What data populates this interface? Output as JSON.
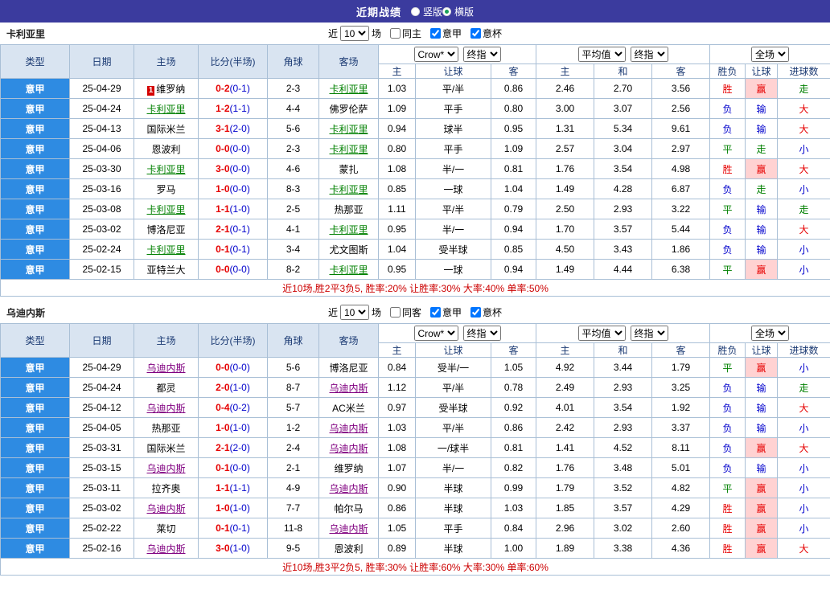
{
  "topbar": {
    "title": "近期战绩",
    "layout_options": [
      {
        "label": "竖版",
        "selected": false
      },
      {
        "label": "横版",
        "selected": true
      }
    ]
  },
  "colors": {
    "topbar_bg": "#3b3b9e",
    "league_blue": "#2e8be2",
    "header_bg": "#d9e4f1",
    "border": "#a9bfd6",
    "win_red": "#e60000",
    "lose_blue": "#0000cc",
    "draw_green": "#008000",
    "focus_green": "#008000",
    "focus_purple": "#800080",
    "summary_red": "#cc0000",
    "win_highlight_bg": "#ffd2d2"
  },
  "result_color_map": {
    "胜": "red",
    "赢": "red",
    "大": "red",
    "负": "blue",
    "输": "blue",
    "小": "blue",
    "平": "green",
    "走": "green"
  },
  "columns": {
    "static": [
      "类型",
      "日期",
      "主场",
      "比分(半场)",
      "角球",
      "客场"
    ],
    "asian_sub": [
      "主",
      "让球",
      "客"
    ],
    "euro_sub": [
      "主",
      "和",
      "客"
    ],
    "result_sub": [
      "胜负",
      "让球",
      "进球数"
    ]
  },
  "sections": [
    {
      "team": "卡利亚里",
      "focus_class": "green",
      "filter": {
        "prefix": "近",
        "count": "10",
        "suffix": "场",
        "checkboxes": [
          {
            "label": "同主",
            "checked": false
          },
          {
            "label": "意甲",
            "checked": true
          },
          {
            "label": "意杯",
            "checked": true
          }
        ]
      },
      "dropdowns": {
        "asian": [
          "Crow*",
          "终指"
        ],
        "euro": [
          "平均值",
          "终指"
        ],
        "result": [
          "全场"
        ]
      },
      "rows": [
        {
          "league": "意甲",
          "date": "25-04-29",
          "home": "维罗纳",
          "home_badge": "1",
          "home_focus": false,
          "score": "0-2",
          "half": "(0-1)",
          "corners": "2-3",
          "away": "卡利亚里",
          "away_focus": true,
          "asian": [
            "1.03",
            "平/半",
            "0.86"
          ],
          "euro": [
            "2.46",
            "2.70",
            "3.56"
          ],
          "results": [
            "胜",
            "赢",
            "走"
          ]
        },
        {
          "league": "意甲",
          "date": "25-04-24",
          "home": "卡利亚里",
          "home_focus": true,
          "score": "1-2",
          "half": "(1-1)",
          "corners": "4-4",
          "away": "佛罗伦萨",
          "away_focus": false,
          "asian": [
            "1.09",
            "平手",
            "0.80"
          ],
          "euro": [
            "3.00",
            "3.07",
            "2.56"
          ],
          "results": [
            "负",
            "输",
            "大"
          ]
        },
        {
          "league": "意甲",
          "date": "25-04-13",
          "home": "国际米兰",
          "home_focus": false,
          "score": "3-1",
          "half": "(2-0)",
          "corners": "5-6",
          "away": "卡利亚里",
          "away_focus": true,
          "asian": [
            "0.94",
            "球半",
            "0.95"
          ],
          "euro": [
            "1.31",
            "5.34",
            "9.61"
          ],
          "results": [
            "负",
            "输",
            "大"
          ]
        },
        {
          "league": "意甲",
          "date": "25-04-06",
          "home": "恩波利",
          "home_focus": false,
          "score": "0-0",
          "half": "(0-0)",
          "corners": "2-3",
          "away": "卡利亚里",
          "away_focus": true,
          "asian": [
            "0.80",
            "平手",
            "1.09"
          ],
          "euro": [
            "2.57",
            "3.04",
            "2.97"
          ],
          "results": [
            "平",
            "走",
            "小"
          ]
        },
        {
          "league": "意甲",
          "date": "25-03-30",
          "home": "卡利亚里",
          "home_focus": true,
          "score": "3-0",
          "half": "(0-0)",
          "corners": "4-6",
          "away": "蒙扎",
          "away_focus": false,
          "asian": [
            "1.08",
            "半/一",
            "0.81"
          ],
          "euro": [
            "1.76",
            "3.54",
            "4.98"
          ],
          "results": [
            "胜",
            "赢",
            "大"
          ]
        },
        {
          "league": "意甲",
          "date": "25-03-16",
          "home": "罗马",
          "home_focus": false,
          "score": "1-0",
          "half": "(0-0)",
          "corners": "8-3",
          "away": "卡利亚里",
          "away_focus": true,
          "asian": [
            "0.85",
            "一球",
            "1.04"
          ],
          "euro": [
            "1.49",
            "4.28",
            "6.87"
          ],
          "results": [
            "负",
            "走",
            "小"
          ]
        },
        {
          "league": "意甲",
          "date": "25-03-08",
          "home": "卡利亚里",
          "home_focus": true,
          "score": "1-1",
          "half": "(1-0)",
          "corners": "2-5",
          "away": "热那亚",
          "away_focus": false,
          "asian": [
            "1.11",
            "平/半",
            "0.79"
          ],
          "euro": [
            "2.50",
            "2.93",
            "3.22"
          ],
          "results": [
            "平",
            "输",
            "走"
          ]
        },
        {
          "league": "意甲",
          "date": "25-03-02",
          "home": "博洛尼亚",
          "home_focus": false,
          "score": "2-1",
          "half": "(0-1)",
          "corners": "4-1",
          "away": "卡利亚里",
          "away_focus": true,
          "asian": [
            "0.95",
            "半/一",
            "0.94"
          ],
          "euro": [
            "1.70",
            "3.57",
            "5.44"
          ],
          "results": [
            "负",
            "输",
            "大"
          ]
        },
        {
          "league": "意甲",
          "date": "25-02-24",
          "home": "卡利亚里",
          "home_focus": true,
          "score": "0-1",
          "half": "(0-1)",
          "corners": "3-4",
          "away": "尤文图斯",
          "away_focus": false,
          "asian": [
            "1.04",
            "受半球",
            "0.85"
          ],
          "euro": [
            "4.50",
            "3.43",
            "1.86"
          ],
          "results": [
            "负",
            "输",
            "小"
          ]
        },
        {
          "league": "意甲",
          "date": "25-02-15",
          "home": "亚特兰大",
          "home_focus": false,
          "score": "0-0",
          "half": "(0-0)",
          "corners": "8-2",
          "away": "卡利亚里",
          "away_focus": true,
          "asian": [
            "0.95",
            "一球",
            "0.94"
          ],
          "euro": [
            "1.49",
            "4.44",
            "6.38"
          ],
          "results": [
            "平",
            "赢",
            "小"
          ]
        }
      ],
      "summary": "近10场,胜2平3负5, 胜率:20% 让胜率:30% 大率:40% 单率:50%"
    },
    {
      "team": "乌迪内斯",
      "focus_class": "purple",
      "filter": {
        "prefix": "近",
        "count": "10",
        "suffix": "场",
        "checkboxes": [
          {
            "label": "同客",
            "checked": false
          },
          {
            "label": "意甲",
            "checked": true
          },
          {
            "label": "意杯",
            "checked": true
          }
        ]
      },
      "dropdowns": {
        "asian": [
          "Crow*",
          "终指"
        ],
        "euro": [
          "平均值",
          "终指"
        ],
        "result": [
          "全场"
        ]
      },
      "rows": [
        {
          "league": "意甲",
          "date": "25-04-29",
          "home": "乌迪内斯",
          "home_focus": true,
          "score": "0-0",
          "half": "(0-0)",
          "corners": "5-6",
          "away": "博洛尼亚",
          "away_focus": false,
          "asian": [
            "0.84",
            "受半/一",
            "1.05"
          ],
          "euro": [
            "4.92",
            "3.44",
            "1.79"
          ],
          "results": [
            "平",
            "赢",
            "小"
          ]
        },
        {
          "league": "意甲",
          "date": "25-04-24",
          "home": "都灵",
          "home_focus": false,
          "score": "2-0",
          "half": "(1-0)",
          "corners": "8-7",
          "away": "乌迪内斯",
          "away_focus": true,
          "asian": [
            "1.12",
            "平/半",
            "0.78"
          ],
          "euro": [
            "2.49",
            "2.93",
            "3.25"
          ],
          "results": [
            "负",
            "输",
            "走"
          ]
        },
        {
          "league": "意甲",
          "date": "25-04-12",
          "home": "乌迪内斯",
          "home_focus": true,
          "score": "0-4",
          "half": "(0-2)",
          "corners": "5-7",
          "away": "AC米兰",
          "away_focus": false,
          "asian": [
            "0.97",
            "受半球",
            "0.92"
          ],
          "euro": [
            "4.01",
            "3.54",
            "1.92"
          ],
          "results": [
            "负",
            "输",
            "大"
          ]
        },
        {
          "league": "意甲",
          "date": "25-04-05",
          "home": "热那亚",
          "home_focus": false,
          "score": "1-0",
          "half": "(1-0)",
          "corners": "1-2",
          "away": "乌迪内斯",
          "away_focus": true,
          "asian": [
            "1.03",
            "平/半",
            "0.86"
          ],
          "euro": [
            "2.42",
            "2.93",
            "3.37"
          ],
          "results": [
            "负",
            "输",
            "小"
          ]
        },
        {
          "league": "意甲",
          "date": "25-03-31",
          "home": "国际米兰",
          "home_focus": false,
          "score": "2-1",
          "half": "(2-0)",
          "corners": "2-4",
          "away": "乌迪内斯",
          "away_focus": true,
          "asian": [
            "1.08",
            "一/球半",
            "0.81"
          ],
          "euro": [
            "1.41",
            "4.52",
            "8.11"
          ],
          "results": [
            "负",
            "赢",
            "大"
          ]
        },
        {
          "league": "意甲",
          "date": "25-03-15",
          "home": "乌迪内斯",
          "home_focus": true,
          "score": "0-1",
          "half": "(0-0)",
          "corners": "2-1",
          "away": "维罗纳",
          "away_focus": false,
          "asian": [
            "1.07",
            "半/一",
            "0.82"
          ],
          "euro": [
            "1.76",
            "3.48",
            "5.01"
          ],
          "results": [
            "负",
            "输",
            "小"
          ]
        },
        {
          "league": "意甲",
          "date": "25-03-11",
          "home": "拉齐奥",
          "home_focus": false,
          "score": "1-1",
          "half": "(1-1)",
          "corners": "4-9",
          "away": "乌迪内斯",
          "away_focus": true,
          "asian": [
            "0.90",
            "半球",
            "0.99"
          ],
          "euro": [
            "1.79",
            "3.52",
            "4.82"
          ],
          "results": [
            "平",
            "赢",
            "小"
          ]
        },
        {
          "league": "意甲",
          "date": "25-03-02",
          "home": "乌迪内斯",
          "home_focus": true,
          "score": "1-0",
          "half": "(1-0)",
          "corners": "7-7",
          "away": "帕尔马",
          "away_focus": false,
          "asian": [
            "0.86",
            "半球",
            "1.03"
          ],
          "euro": [
            "1.85",
            "3.57",
            "4.29"
          ],
          "results": [
            "胜",
            "赢",
            "小"
          ]
        },
        {
          "league": "意甲",
          "date": "25-02-22",
          "home": "莱切",
          "home_focus": false,
          "score": "0-1",
          "half": "(0-1)",
          "corners": "11-8",
          "away": "乌迪内斯",
          "away_focus": true,
          "asian": [
            "1.05",
            "平手",
            "0.84"
          ],
          "euro": [
            "2.96",
            "3.02",
            "2.60"
          ],
          "results": [
            "胜",
            "赢",
            "小"
          ]
        },
        {
          "league": "意甲",
          "date": "25-02-16",
          "home": "乌迪内斯",
          "home_focus": true,
          "score": "3-0",
          "half": "(1-0)",
          "corners": "9-5",
          "away": "恩波利",
          "away_focus": false,
          "asian": [
            "0.89",
            "半球",
            "1.00"
          ],
          "euro": [
            "1.89",
            "3.38",
            "4.36"
          ],
          "results": [
            "胜",
            "赢",
            "大"
          ]
        }
      ],
      "summary": "近10场,胜3平2负5, 胜率:30% 让胜率:60% 大率:30% 单率:60%"
    }
  ]
}
